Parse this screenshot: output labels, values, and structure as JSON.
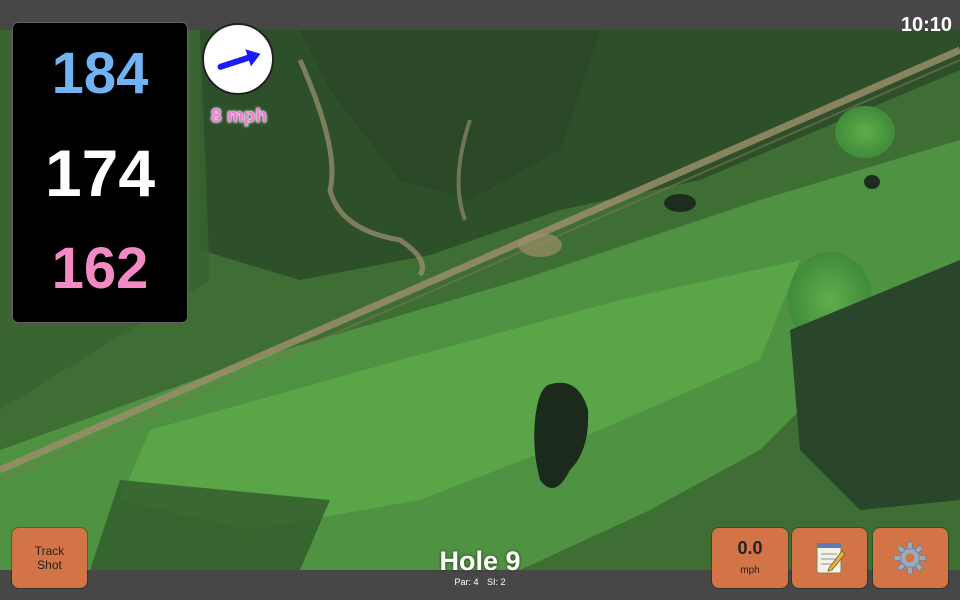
{
  "status": {
    "time": "10:10"
  },
  "distances": {
    "back": "184",
    "middle": "174",
    "front": "162"
  },
  "wind": {
    "speed_label": "8 mph",
    "direction": "east-northeast"
  },
  "buttons": {
    "track_shot_line1": "Track",
    "track_shot_line2": "Shot",
    "speed_value": "0.0",
    "speed_unit": "mph",
    "notes_icon": "notepad-icon",
    "settings_icon": "gear-icon"
  },
  "hole": {
    "title": "Hole 9",
    "par": "Par: 4",
    "si": "SI: 2"
  },
  "colors": {
    "back": "#6fb3f5",
    "middle": "#ffffff",
    "front": "#f48ac3",
    "wind_arrow": "#1a1aff",
    "wind_text": "#f07ad6",
    "button": "#d27446"
  }
}
